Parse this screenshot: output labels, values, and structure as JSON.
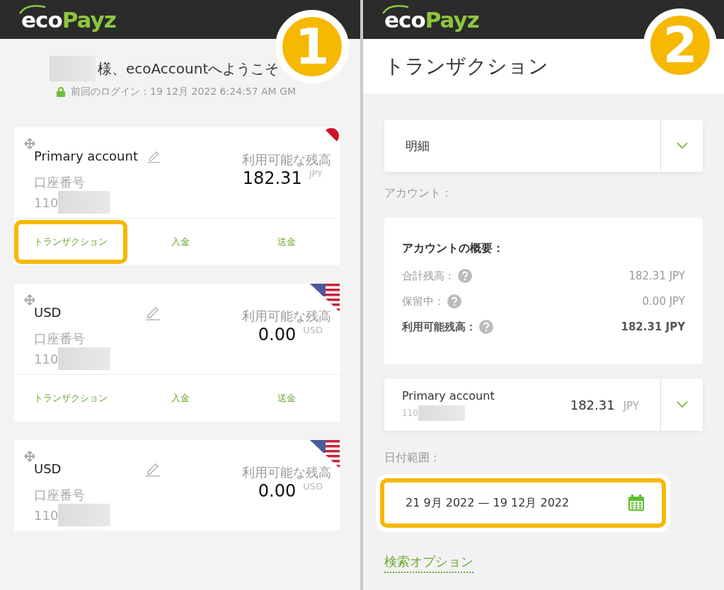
{
  "panels": [
    {
      "logo": {
        "first": "eco",
        "second": "Payz"
      },
      "badge": "1",
      "greeting": {
        "text": "様、ecoAccountへようこそ",
        "last_login": "前回のログイン：19 12月 2022 6:24:57 AM GM"
      },
      "accounts": [
        {
          "name": "Primary account",
          "kind": "jp",
          "balance_label": "利用可能な残高",
          "amount": "182.31",
          "currency": "JPY",
          "number_label": "口座番号",
          "number": "110",
          "actions": [
            {
              "label": "トランザクション",
              "highlighted": true
            },
            {
              "label": "入金",
              "highlighted": false
            },
            {
              "label": "送金",
              "highlighted": false
            }
          ]
        },
        {
          "name": "USD",
          "kind": "us",
          "balance_label": "利用可能な残高",
          "amount": "0.00",
          "currency": "USD",
          "number_label": "口座番号",
          "number": "110",
          "actions": [
            {
              "label": "トランザクション",
              "highlighted": false
            },
            {
              "label": "入金",
              "highlighted": false
            },
            {
              "label": "送金",
              "highlighted": false
            }
          ]
        },
        {
          "name": "USD",
          "kind": "us",
          "balance_label": "利用可能な残高",
          "amount": "0.00",
          "currency": "USD",
          "number_label": "口座番号",
          "number": "110"
        }
      ]
    },
    {
      "logo": {
        "first": "eco",
        "second": "Payz"
      },
      "badge": "2",
      "title": "トランザクション",
      "type_select": {
        "value": "明細"
      },
      "account_label": "アカウント：",
      "summary": {
        "heading": "アカウントの概要：",
        "rows": [
          {
            "label": "合計残高：",
            "value": "182.31 JPY",
            "emphasized": false
          },
          {
            "label": "保留中：",
            "value": "0.00 JPY",
            "emphasized": false
          },
          {
            "label": "利用可能残高：",
            "value": "182.31 JPY",
            "emphasized": true
          }
        ]
      },
      "account_select": {
        "name": "Primary account",
        "number": "110",
        "amount": "182.31",
        "currency": "JPY"
      },
      "date_label": "日付範囲：",
      "date_range": {
        "value": "21 9月 2022 — 19 12月 2022",
        "highlighted": true
      },
      "search_options": "検索オプション"
    }
  ]
}
